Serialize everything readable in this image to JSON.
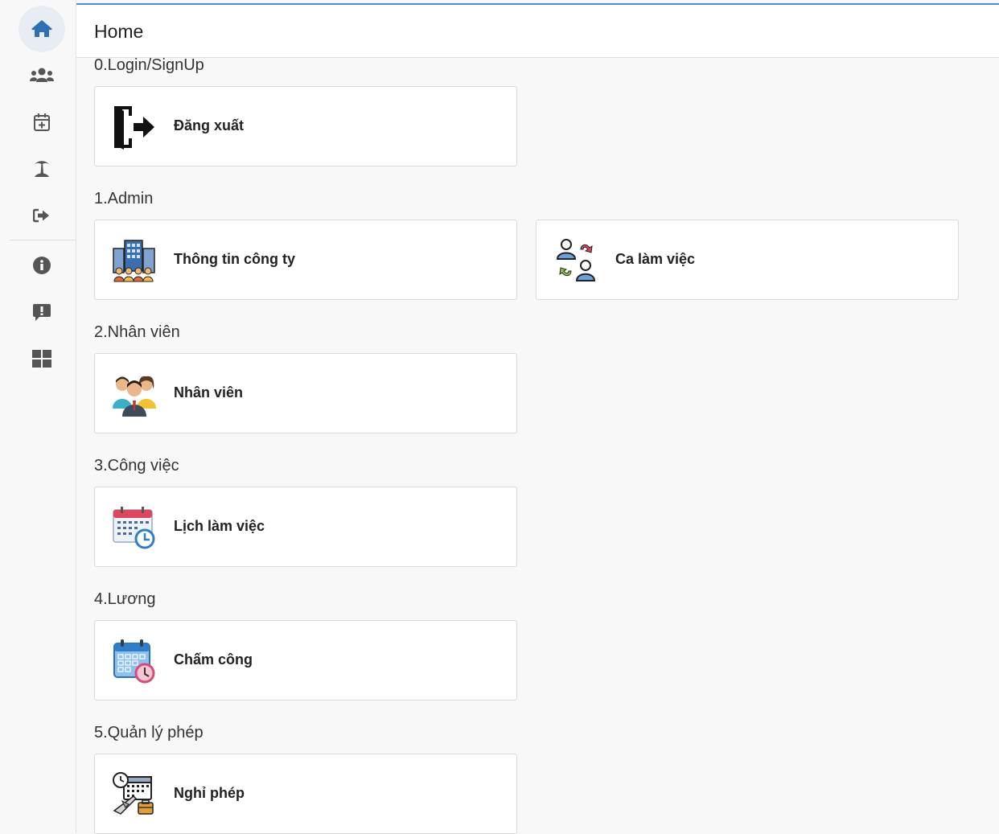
{
  "header": {
    "title": "Home"
  },
  "sidebar": {
    "items": [
      {
        "icon": "home-icon"
      },
      {
        "icon": "users-icon"
      },
      {
        "icon": "calendar-plus-icon"
      },
      {
        "icon": "island-icon"
      },
      {
        "icon": "sign-out-icon"
      },
      {
        "icon": "info-icon"
      },
      {
        "icon": "feedback-icon"
      },
      {
        "icon": "grid-icon"
      }
    ]
  },
  "sections": [
    {
      "title": "0.Login/SignUp",
      "cards": [
        {
          "label": "Đăng xuất",
          "icon": "logout-door-icon"
        }
      ]
    },
    {
      "title": "1.Admin",
      "cards": [
        {
          "label": "Thông tin công ty",
          "icon": "company-building-icon"
        },
        {
          "label": "Ca làm việc",
          "icon": "shift-swap-icon"
        }
      ]
    },
    {
      "title": "2.Nhân viên",
      "cards": [
        {
          "label": "Nhân viên",
          "icon": "employees-icon"
        }
      ]
    },
    {
      "title": "3.Công việc",
      "cards": [
        {
          "label": "Lịch làm việc",
          "icon": "work-calendar-icon"
        }
      ]
    },
    {
      "title": "4.Lương",
      "cards": [
        {
          "label": "Chấm công",
          "icon": "timesheet-calendar-icon"
        }
      ]
    },
    {
      "title": "5.Quản lý phép",
      "cards": [
        {
          "label": "Nghỉ phép",
          "icon": "vacation-icon"
        }
      ]
    }
  ]
}
